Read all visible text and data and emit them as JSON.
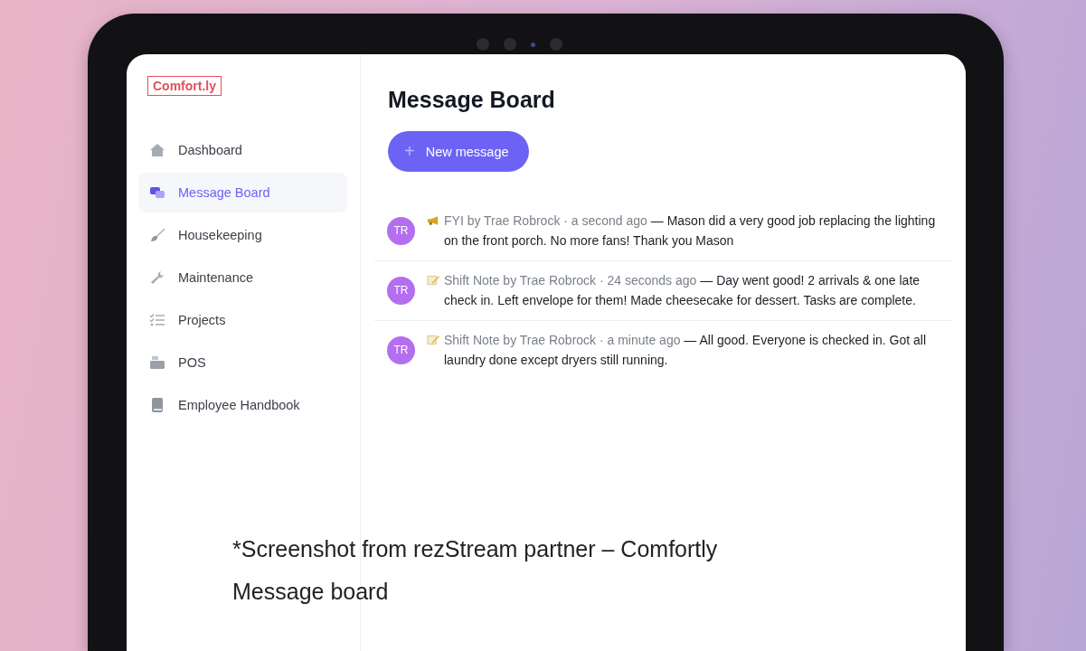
{
  "sidebar": {
    "logo": "Comfort.ly",
    "items": [
      {
        "label": "Dashboard",
        "selected": false
      },
      {
        "label": "Message Board",
        "selected": true
      },
      {
        "label": "Housekeeping",
        "selected": false
      },
      {
        "label": "Maintenance",
        "selected": false
      },
      {
        "label": "Projects",
        "selected": false
      },
      {
        "label": "POS",
        "selected": false
      },
      {
        "label": "Employee Handbook",
        "selected": false
      }
    ]
  },
  "main": {
    "title": "Message Board",
    "new_button": {
      "icon": "+",
      "label": "New message"
    },
    "messages": [
      {
        "kind": "fyi",
        "avatar": "TR",
        "meta": "FYI by Trae Robrock · a second ago",
        "body": "— Mason did a very good job replacing the lighting on the front porch. No more fans! Thank you Mason"
      },
      {
        "kind": "shift_note",
        "avatar": "TR",
        "meta": "Shift Note by Trae Robrock · 24 seconds ago",
        "body": "— Day went good! 2 arrivals & one late check in. Left envelope for them! Made cheesecake for dessert. Tasks are complete."
      },
      {
        "kind": "shift_note",
        "avatar": "TR",
        "meta": "Shift Note by Trae Robrock · a minute ago",
        "body": "— All good. Everyone is checked in. Got all laundry done except dryers still running."
      }
    ]
  },
  "caption": {
    "lines": [
      "*Screenshot from rezStream partner – Comfortly",
      "Message board"
    ]
  }
}
